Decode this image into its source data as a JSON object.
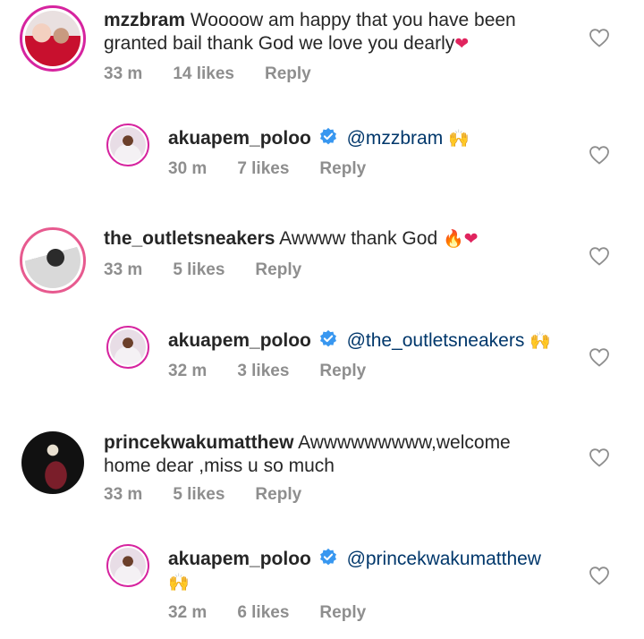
{
  "comments": [
    {
      "username": "mzzbram",
      "text": " Woooow am happy that you have been granted bail thank God we love you dearly",
      "emoji": "❤",
      "time": "33 m",
      "likes": "14 likes",
      "reply": "Reply"
    },
    {
      "username": "akuapem_poloo",
      "mention": "@mzzbram",
      "emoji": "🙌",
      "time": "30 m",
      "likes": "7 likes",
      "reply": "Reply"
    },
    {
      "username": "the_outletsneakers",
      "text": " Awwww thank God ",
      "emoji": "🔥❤",
      "time": "33 m",
      "likes": "5 likes",
      "reply": "Reply"
    },
    {
      "username": "akuapem_poloo",
      "mention": "@the_outletsneakers",
      "emoji": "🙌",
      "time": "32 m",
      "likes": "3 likes",
      "reply": "Reply"
    },
    {
      "username": "princekwakumatthew",
      "text": " Awwwwwwwww,welcome home dear ,miss u so much",
      "time": "33 m",
      "likes": "5 likes",
      "reply": "Reply"
    },
    {
      "username": "akuapem_poloo",
      "mention": "@princekwakumatthew",
      "emoji": "🙌",
      "time": "32 m",
      "likes": "6 likes",
      "reply": "Reply"
    }
  ],
  "colors": {
    "text": "#262626",
    "meta": "#8e8e8e",
    "mention": "#00376b",
    "verified": "#3897f0",
    "story_ring": "#d6249f"
  }
}
